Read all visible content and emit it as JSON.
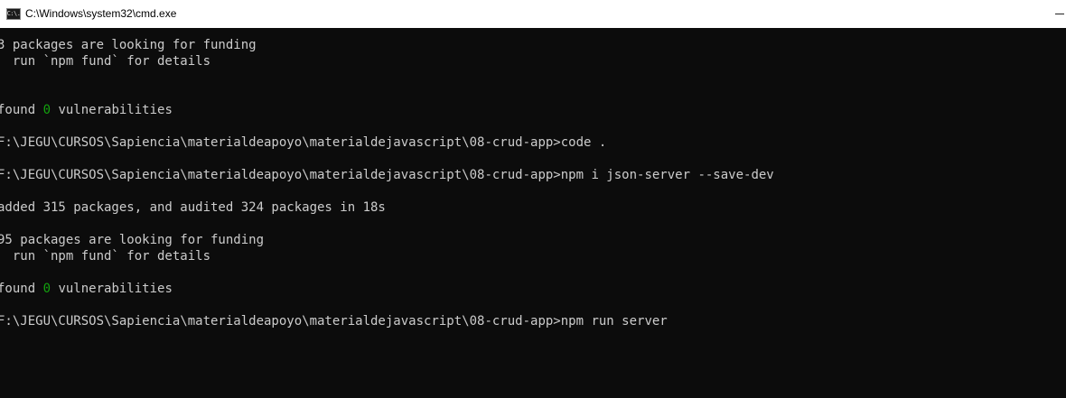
{
  "window": {
    "title": "C:\\Windows\\system32\\cmd.exe",
    "icon_name": "cmd-icon",
    "icon_glyph": "C:\\."
  },
  "console": {
    "lines": [
      "3 packages are looking for funding",
      "  run `npm fund` for details",
      "",
      "found ",
      "",
      "F:\\JEGU\\CURSOS\\Sapiencia\\materialdeapoyo\\materialdejavascript\\08-crud-app>code .",
      "",
      "F:\\JEGU\\CURSOS\\Sapiencia\\materialdeapoyo\\materialdejavascript\\08-crud-app>npm i json-server --save-dev",
      "",
      "added 315 packages, and audited 324 packages in 18s",
      "",
      "95 packages are looking for funding",
      "  run `npm fund` for details",
      "",
      "found ",
      "",
      "F:\\JEGU\\CURSOS\\Sapiencia\\materialdeapoyo\\materialdejavascript\\08-crud-app>npm run server"
    ],
    "vuln_prefix": "found ",
    "vuln_count": "0",
    "vuln_suffix": " vulnerabilities",
    "colors": {
      "background": "#0c0c0c",
      "text": "#cccccc",
      "vuln_count": "#13a10e"
    }
  }
}
